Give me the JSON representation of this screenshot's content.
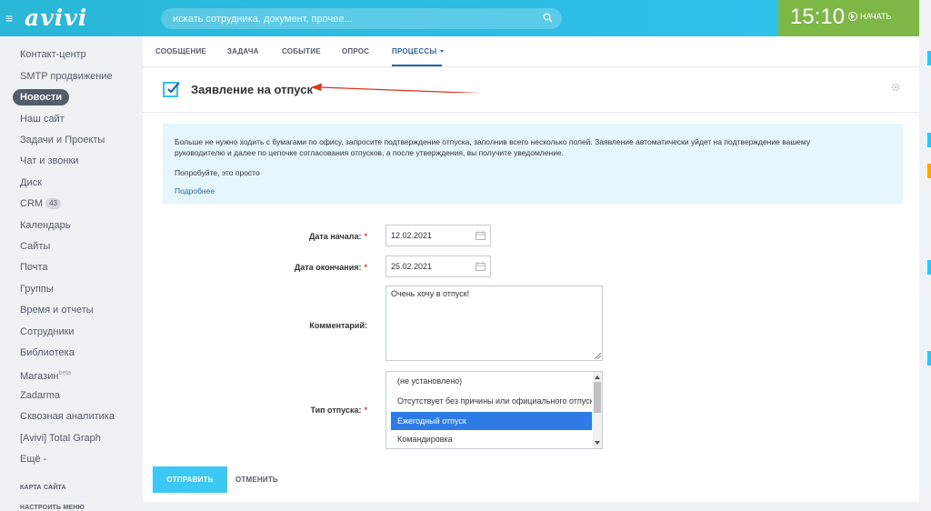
{
  "header": {
    "logo": "avivi",
    "search_placeholder": "искать сотрудника, документ, прочее...",
    "time": "15:10",
    "start_label": "НАЧАТЬ"
  },
  "sidebar": {
    "items": [
      {
        "label": "Контакт-центр"
      },
      {
        "label": "SMTP продвижение"
      },
      {
        "label": "Новости",
        "active": true
      },
      {
        "label": "Наш сайт"
      },
      {
        "label": "Задачи и Проекты"
      },
      {
        "label": "Чат и звонки"
      },
      {
        "label": "Диск"
      },
      {
        "label": "CRM",
        "badge": "43"
      },
      {
        "label": "Календарь"
      },
      {
        "label": "Сайты"
      },
      {
        "label": "Почта"
      },
      {
        "label": "Группы"
      },
      {
        "label": "Время и отчеты"
      },
      {
        "label": "Сотрудники"
      },
      {
        "label": "Библиотека"
      },
      {
        "label": "Магазин",
        "sup": "beta"
      },
      {
        "label": "Zadarma"
      },
      {
        "label": "Сквозная аналитика"
      },
      {
        "label": "[Avivi] Total Graph"
      },
      {
        "label": "Ещё -"
      }
    ],
    "site_map": "КАРТА САЙТА",
    "settings_menu": "НАСТРОИТЬ МЕНЮ"
  },
  "tabs": [
    {
      "label": "СООБЩЕНИЕ"
    },
    {
      "label": "ЗАДАЧА"
    },
    {
      "label": "СОБЫТИЕ"
    },
    {
      "label": "ОПРОС"
    },
    {
      "label": "ПРОЦЕССЫ",
      "active": true
    }
  ],
  "form": {
    "title": "Заявление на отпуск",
    "info_line1": "Больше не нужно ходить с бумагами по офису, запросите подтверждение отпуска, заполнив всего несколько полей. Заявление автоматически уйдет на подтверждение вашему",
    "info_line2": "руководителю и далее по цепочке согласования отпусков, а после утверждения, вы получите уведомление.",
    "info_line3": "Попробуйте, это просто",
    "more_link": "Подробнее",
    "start_label": "Дата начала:",
    "start_value": "12.02.2021",
    "end_label": "Дата окончания:",
    "end_value": "25.02.2021",
    "comment_label": "Комментарий:",
    "comment_value": "Очень хочу в отпуск!",
    "type_label": "Тип отпуска:",
    "required_mark": "*",
    "type_options": [
      "(не установлено)",
      "Отсутствует без причины или официального отпуска",
      "Ежегодный отпуск",
      "Командировка"
    ],
    "type_selected": "Ежегодный отпуск",
    "submit": "ОТПРАВИТЬ",
    "cancel": "ОТМЕНИТЬ"
  },
  "colors": {
    "header": "#2fc6f6",
    "time_block": "#7db847",
    "accent_blue": "#2067b0",
    "submit": "#3bc8f5",
    "info_bg": "#e5f7fd",
    "arrow": "#e0311f"
  }
}
